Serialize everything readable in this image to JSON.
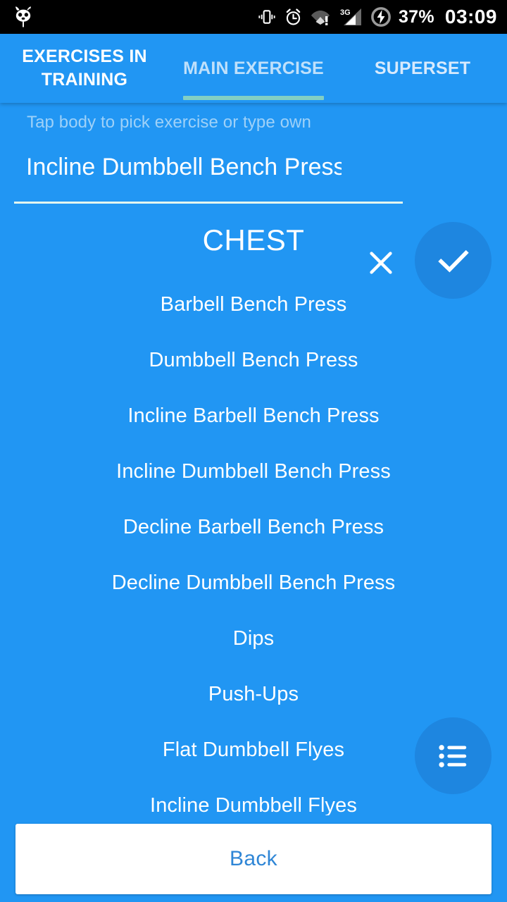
{
  "status_bar": {
    "logo_icon": "cyanogenmod-logo-icon",
    "icons": [
      "vibrate-icon",
      "alarm-clock-icon",
      "wifi-warning-icon",
      "signal-3g-icon",
      "battery-charging-icon"
    ],
    "network_label": "3G",
    "battery_percent": "37%",
    "time": "03:09",
    "background_color": "#000000",
    "foreground_color": "#ffffff"
  },
  "tabs": {
    "items": [
      {
        "label": "EXERCISES IN TRAINING",
        "active": false
      },
      {
        "label": "MAIN EXERCISE",
        "active": true
      },
      {
        "label": "SUPERSET",
        "active": false
      }
    ],
    "indicator_color": "#82cfc4",
    "bar_color": "#2196f3"
  },
  "input": {
    "hint": "Tap body to pick exercise or type own",
    "value": "Incline Dumbbell Bench Press",
    "clear_icon": "close-icon",
    "confirm_icon": "check-icon",
    "underline_color": "#e3f5ef"
  },
  "list": {
    "group_title": "CHEST",
    "exercises": [
      "Barbell Bench Press",
      "Dumbbell Bench Press",
      "Incline Barbell Bench Press",
      "Incline Dumbbell Bench Press",
      "Decline Barbell Bench Press",
      "Decline Dumbbell Bench Press",
      "Dips",
      "Push-Ups",
      "Flat Dumbbell Flyes",
      "Incline Dumbbell Flyes"
    ]
  },
  "fab_list": {
    "icon": "list-icon",
    "color": "#1e86e0"
  },
  "bottom_bar": {
    "back_label": "Back",
    "back_text_color": "#2f86d6",
    "back_background": "#ffffff"
  },
  "theme": {
    "background": "#2196f3",
    "accent": "#1e86e0",
    "text_primary": "#ffffff",
    "text_hint": "#9ed1f8"
  }
}
